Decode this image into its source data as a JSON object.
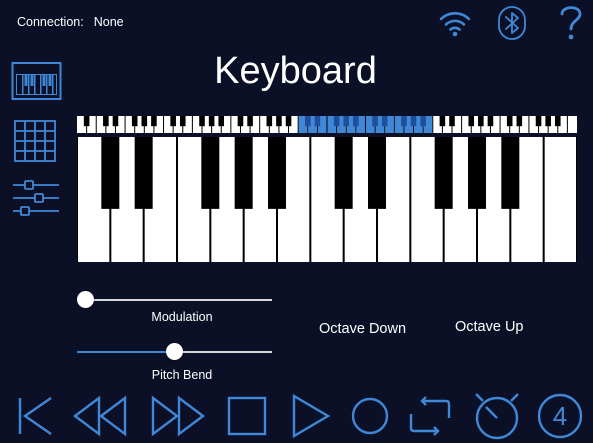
{
  "connection": {
    "label": "Connection:",
    "value": "None"
  },
  "page_title": "Keyboard",
  "top_icons": [
    "wifi-icon",
    "bluetooth-icon",
    "help-icon"
  ],
  "side_nav": [
    {
      "name": "keyboard-mode",
      "icon": "piano-icon"
    },
    {
      "name": "pads-mode",
      "icon": "grid-icon"
    },
    {
      "name": "mixer-mode",
      "icon": "sliders-icon"
    }
  ],
  "keyboard": {
    "overview_white_keys": 52,
    "overview_highlight_start": 23,
    "overview_highlight_count": 14,
    "visible_white_keys": 15,
    "first_note": "C"
  },
  "controls": {
    "modulation": {
      "label": "Modulation",
      "value": 0
    },
    "pitch_bend": {
      "label": "Pitch Bend",
      "value": 0.5
    },
    "octave_down": "Octave Down",
    "octave_up": "Octave Up"
  },
  "transport": {
    "buttons": [
      "skip-back-icon",
      "rewind-icon",
      "fast-forward-icon",
      "stop-icon",
      "play-icon",
      "record-icon",
      "loop-icon",
      "metronome-icon",
      "count-in-icon"
    ],
    "count_in": "4"
  },
  "colors": {
    "background": "#0b1026",
    "accent": "#3f88d8",
    "white_key": "#ffffff",
    "black_key": "#000000"
  }
}
